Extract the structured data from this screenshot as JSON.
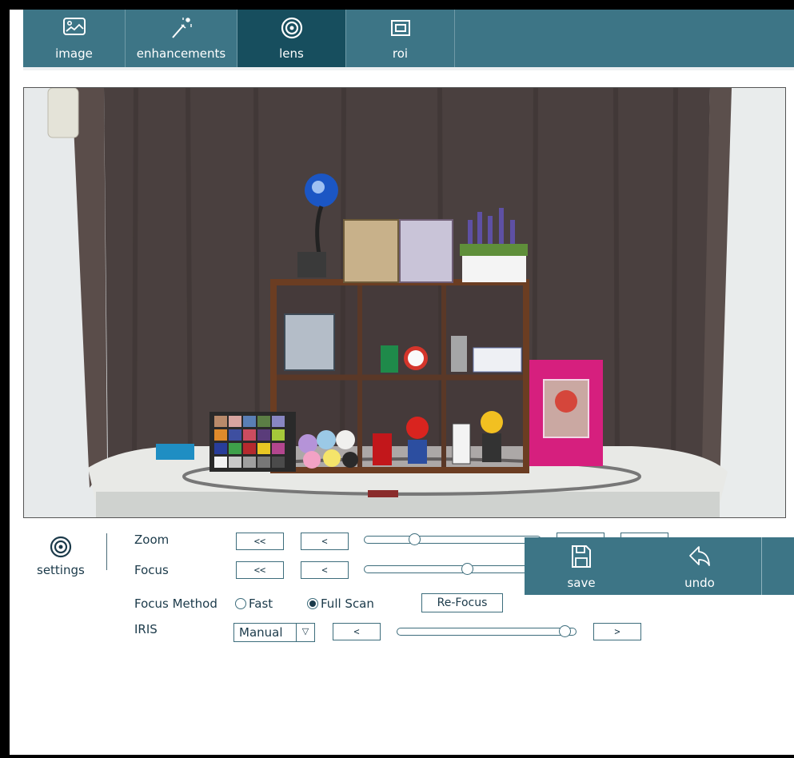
{
  "tabs": [
    {
      "label": "image",
      "icon": "image-icon"
    },
    {
      "label": "enhancements",
      "icon": "magic-wand-icon"
    },
    {
      "label": "lens",
      "icon": "lens-icon",
      "active": true
    },
    {
      "label": "roi",
      "icon": "roi-icon"
    }
  ],
  "settings": {
    "label": "settings",
    "icon": "lens-settings-icon"
  },
  "zoom": {
    "label": "Zoom",
    "btn_far_left": "<<",
    "btn_left": "<",
    "btn_right": ">",
    "btn_far_right": ">>",
    "level": 0.27
  },
  "focus": {
    "label": "Focus",
    "btn_far_left": "<<",
    "btn_left": "<",
    "btn_right": ">",
    "btn_far_right": ">>",
    "level": 0.59
  },
  "focus_method": {
    "label": "Focus Method",
    "option_fast": "Fast",
    "option_full": "Full Scan",
    "selected": "Full Scan",
    "refocus": "Re-Focus"
  },
  "iris": {
    "label": "IRIS",
    "mode": "Manual",
    "mode_arrow": "▽",
    "btn_left": "<",
    "btn_right": ">",
    "level": 0.97
  },
  "actions": {
    "save": "save",
    "undo": "undo"
  },
  "colors": {
    "accent": "#3d7586",
    "accent_active": "#174e5e"
  }
}
